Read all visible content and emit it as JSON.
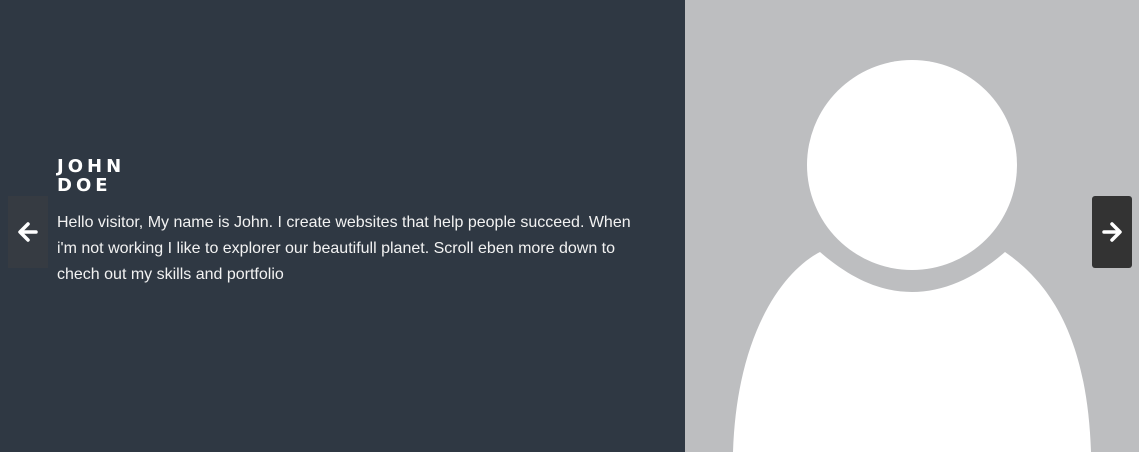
{
  "profile": {
    "first_name": "JOHN",
    "last_name": "DOE",
    "bio": "Hello visitor, My name is John. I create websites that help people succeed. When i'm not working I like to explorer our beautifull planet. Scroll eben more down to chech out my skills and portfolio"
  },
  "navigation": {
    "prev_icon": "arrow-left-icon",
    "next_icon": "arrow-right-icon"
  },
  "colors": {
    "panel_dark": "#2f3843",
    "panel_light": "#bdbec0",
    "avatar": "#ffffff",
    "button": "#333333"
  },
  "avatar": {
    "icon": "user-silhouette-icon"
  }
}
